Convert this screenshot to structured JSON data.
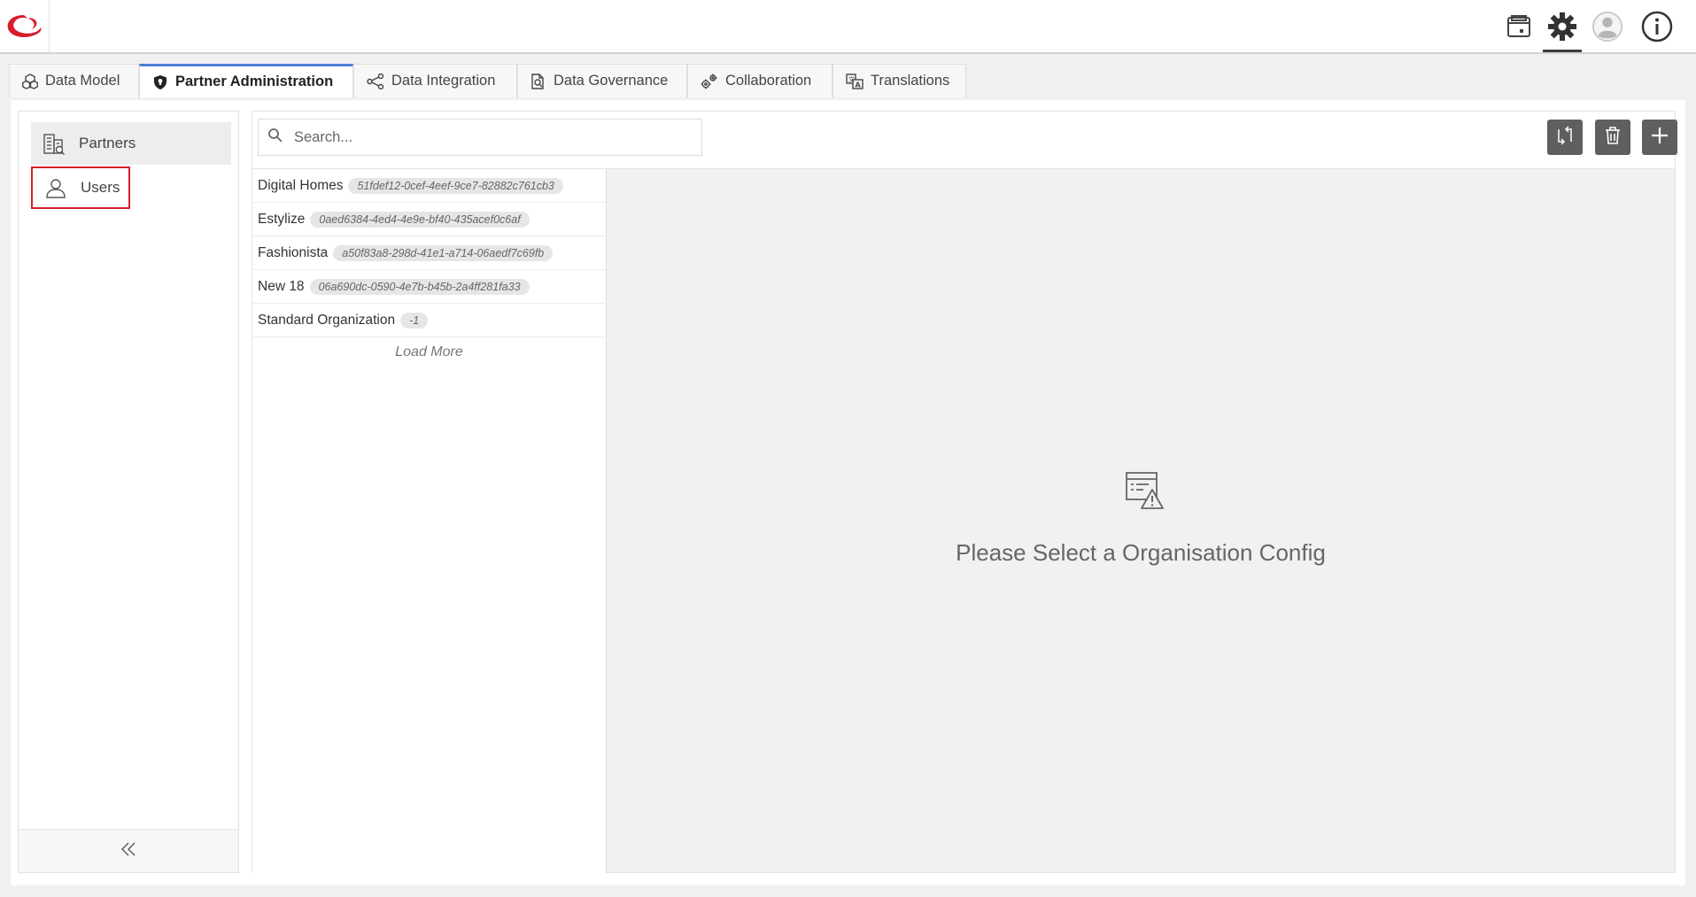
{
  "header": {
    "logo": "brand-logo",
    "icons": [
      "calendar-icon",
      "gear-icon",
      "user-avatar-icon",
      "info-icon"
    ]
  },
  "tabs": [
    {
      "label": "Data Model",
      "icon": "cubes-icon"
    },
    {
      "label": "Partner Administration",
      "icon": "shield-icon",
      "active": true
    },
    {
      "label": "Data Integration",
      "icon": "share-nodes-icon"
    },
    {
      "label": "Data Governance",
      "icon": "doc-search-icon"
    },
    {
      "label": "Collaboration",
      "icon": "gears-icon"
    },
    {
      "label": "Translations",
      "icon": "translate-icon"
    }
  ],
  "sidebar": {
    "items": [
      {
        "label": "Partners",
        "icon": "building-icon"
      },
      {
        "label": "Users",
        "icon": "user-icon"
      }
    ],
    "collapse_icon": "double-chevron-left-icon"
  },
  "search": {
    "placeholder": "Search..."
  },
  "toolbar": {
    "icons": [
      "sync-icon",
      "trash-icon",
      "plus-icon"
    ]
  },
  "organizations": [
    {
      "name": "Digital Homes",
      "id": "51fdef12-0cef-4eef-9ce7-82882c761cb3"
    },
    {
      "name": "Estylize",
      "id": "0aed6384-4ed4-4e9e-bf40-435acef0c6af"
    },
    {
      "name": "Fashionista",
      "id": "a50f83a8-298d-41e1-a714-06aedf7c69fb"
    },
    {
      "name": "New 18",
      "id": "06a690dc-0590-4e7b-b45b-2a4ff281fa33"
    },
    {
      "name": "Standard Organization",
      "id": "-1"
    }
  ],
  "load_more": "Load More",
  "empty_state": {
    "message": "Please Select a Organisation Config",
    "icon": "doc-warning-icon"
  },
  "colors": {
    "accent": "#4a7fd9",
    "highlight": "#d81e2a",
    "brand": "#d81e2a"
  }
}
